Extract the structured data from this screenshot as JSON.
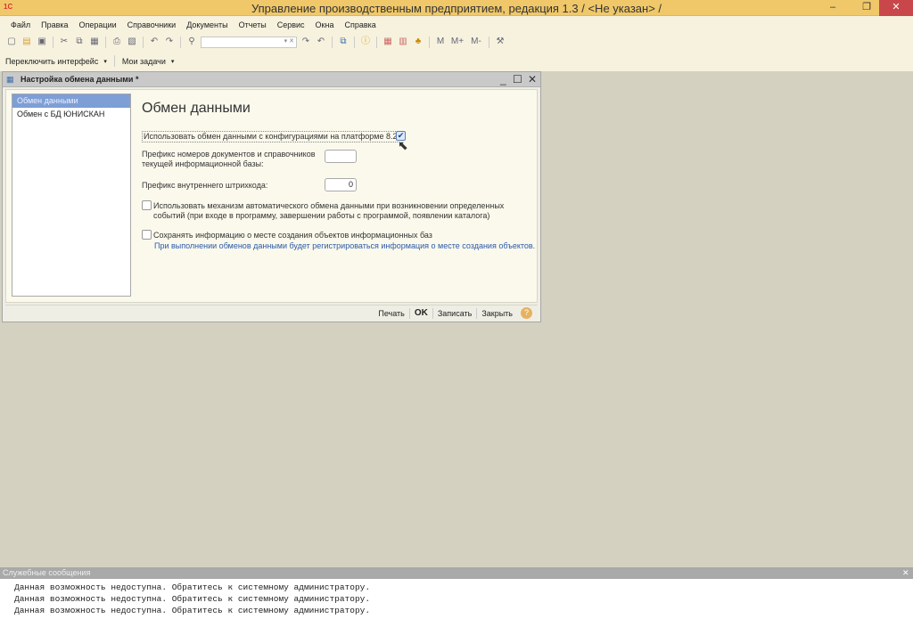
{
  "window": {
    "title": "Управление производственным предприятием, редакция 1.3 / <Не указан> /",
    "logo": "1С",
    "controls": [
      "minimize",
      "restore",
      "close"
    ]
  },
  "menu": [
    "Файл",
    "Правка",
    "Операции",
    "Справочники",
    "Документы",
    "Отчеты",
    "Сервис",
    "Окна",
    "Справка"
  ],
  "toolbar": {
    "icons": [
      "new-icon",
      "open-icon",
      "save-icon",
      "cut-icon",
      "copy-icon",
      "paste-icon",
      "print-icon",
      "preview-icon",
      "undo-icon",
      "redo-icon",
      "search-icon",
      "search-next-icon",
      "search-prev-icon",
      "windows-icon",
      "info-icon",
      "calculator-icon",
      "calendar-icon",
      "users-icon",
      "settings-icon"
    ],
    "memory": [
      "M",
      "M+",
      "M-"
    ],
    "search_value": ""
  },
  "toolbar2": {
    "switch_interface": "Переключить интерфейс",
    "my_tasks": "Мои задачи"
  },
  "form": {
    "title": "Настройка обмена данными *",
    "nav": [
      {
        "label": "Обмен данными",
        "selected": true
      },
      {
        "label": "Обмен с БД ЮНИСКАН",
        "selected": false
      }
    ],
    "heading": "Обмен данными",
    "use_82_label": "Использовать обмен данными с конфигурациями на платформе 8.2",
    "use_82_checked": true,
    "prefix_label": "Префикс номеров документов и справочников текущей информационной базы:",
    "prefix_value": "",
    "barcode_label": "Префикс внутреннего штрихкода:",
    "barcode_value": "0",
    "auto_label": "Использовать механизм автоматического обмена данными при возникновении определенных событий (при входе в программу, завершении работы с программой, появлении каталога)",
    "auto_checked": false,
    "save_origin_label": "Сохранять информацию о месте создания объектов информационных баз",
    "save_origin_checked": false,
    "save_origin_hint": "При выполнении обменов данными будет регистрироваться информация о месте создания объектов.",
    "buttons": {
      "print": "Печать",
      "ok": "OK",
      "write": "Записать",
      "close": "Закрыть",
      "help": "?"
    }
  },
  "messages": {
    "title": "Служебные сообщения",
    "items": [
      "Данная возможность недоступна. Обратитесь к системному администратору.",
      "Данная возможность недоступна. Обратитесь к системному администратору.",
      "Данная возможность недоступна. Обратитесь к системному администратору."
    ]
  },
  "colors": {
    "titlebar": "#f0c86a",
    "close": "#c9474a",
    "selection": "#7d9fd6",
    "hint": "#2b5aa8"
  }
}
